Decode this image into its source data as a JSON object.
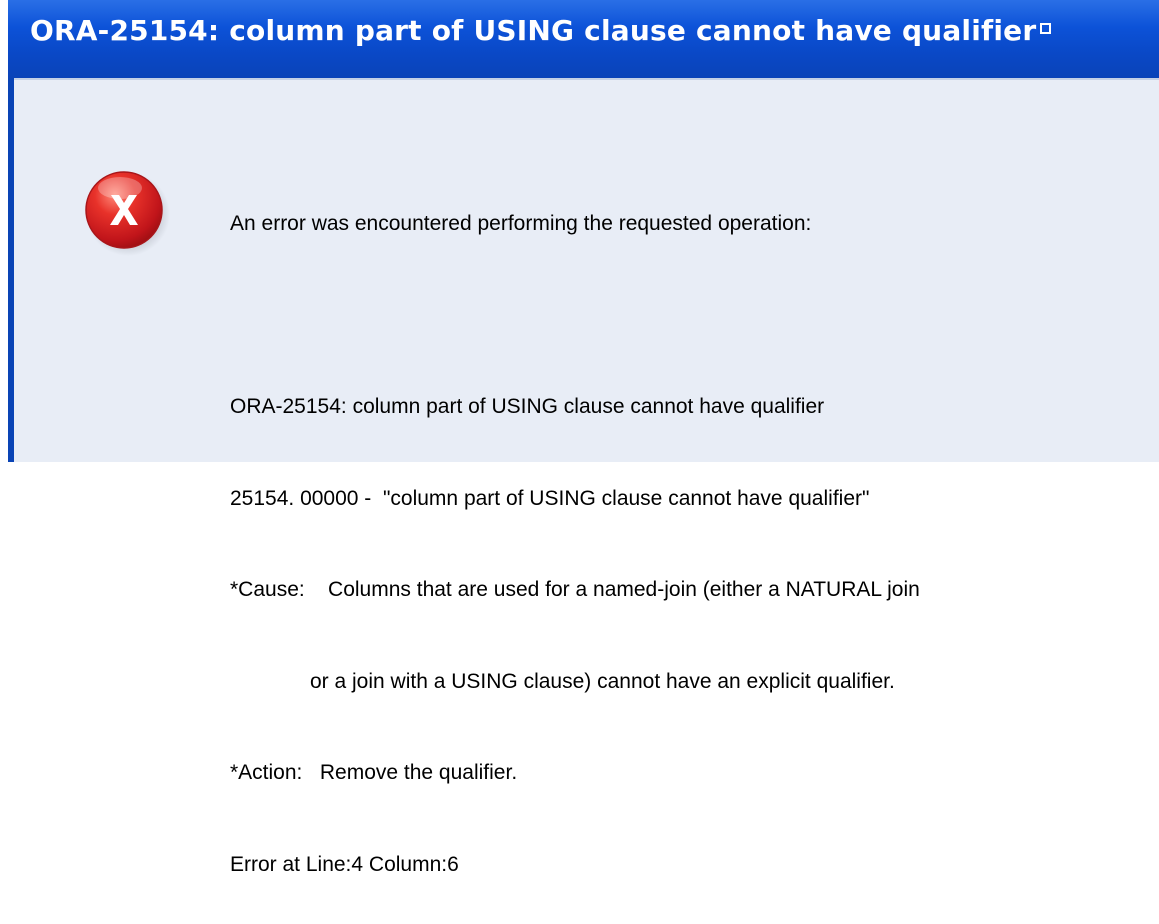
{
  "dialog": {
    "title": "ORA-25154: column part of USING clause cannot have qualifier",
    "icon": "error-x-icon",
    "title_bar_color": "#0a4ac8",
    "icon_color": "#d81e1e"
  },
  "message": {
    "intro": "An error was encountered performing the requested operation:",
    "lines": [
      "ORA-25154: column part of USING clause cannot have qualifier",
      "25154. 00000 -  \"column part of USING clause cannot have qualifier\"",
      "*Cause:    Columns that are used for a named-join (either a NATURAL join",
      "or a join with a USING clause) cannot have an explicit qualifier.",
      "*Action:   Remove the qualifier.",
      "Error at Line:4 Column:6"
    ]
  }
}
